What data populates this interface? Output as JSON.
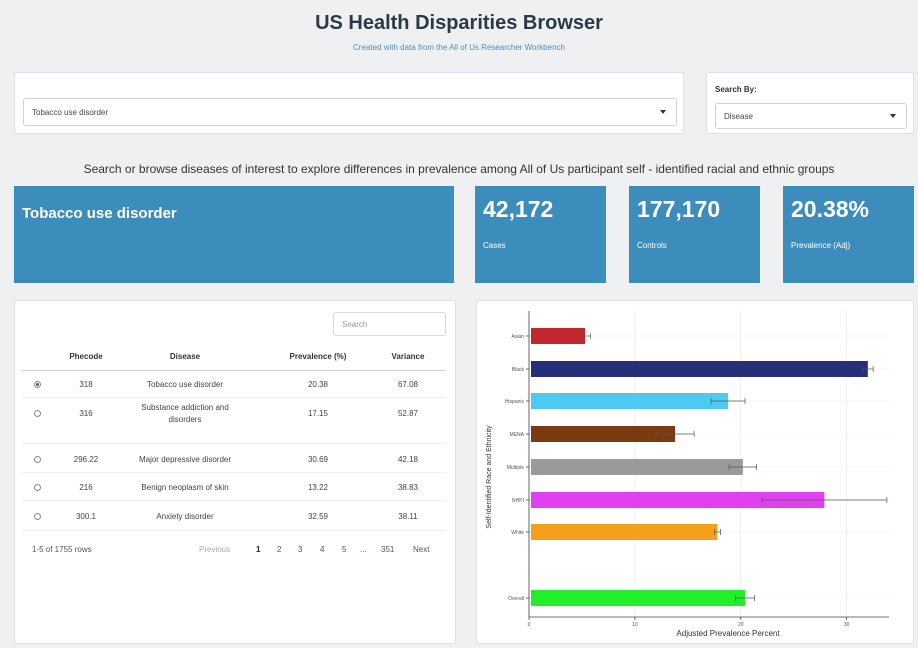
{
  "app": {
    "title": "US Health Disparities Browser",
    "subtitle": "Created with data from the All of Us Researcher Workbench"
  },
  "disease_select": {
    "value": "Tobacco use disorder"
  },
  "search_by": {
    "label": "Search By:",
    "value": "Disease"
  },
  "tagline": "Search or browse diseases of interest to explore differences in prevalence among All of Us participant self - identified racial and ethnic groups",
  "summary": {
    "disease": "Tobacco use disorder",
    "cases_value": "42,172",
    "cases_label": "Cases",
    "controls_value": "177,170",
    "controls_label": "Controls",
    "prevalence_value": "20.38%",
    "prevalence_label": "Prevalence (Adj)",
    "box_color": "#3c8dbc"
  },
  "table": {
    "search_placeholder": "Search",
    "columns": [
      "Phecode",
      "Disease",
      "Prevalence (%)",
      "Variance"
    ],
    "rows": [
      {
        "selected": true,
        "phecode": "318",
        "disease": "Tobacco use disorder",
        "prevalence": "20.38",
        "variance": "67.08"
      },
      {
        "selected": false,
        "phecode": "316",
        "disease": "Substance addiction and disorders",
        "prevalence": "17.15",
        "variance": "52.87"
      },
      {
        "selected": false,
        "phecode": "296.22",
        "disease": "Major depressive disorder",
        "prevalence": "30.69",
        "variance": "42.18"
      },
      {
        "selected": false,
        "phecode": "216",
        "disease": "Benign neoplasm of skin",
        "prevalence": "13.22",
        "variance": "38.83"
      },
      {
        "selected": false,
        "phecode": "300.1",
        "disease": "Anxiety disorder",
        "prevalence": "32.59",
        "variance": "38.11"
      }
    ],
    "info": "1-5 of 1755 rows",
    "pager": {
      "previous": "Previous",
      "pages": [
        "1",
        "2",
        "3",
        "4",
        "5",
        "...",
        "351"
      ],
      "next": "Next",
      "current": "1"
    }
  },
  "chart_data": {
    "type": "bar",
    "orientation": "horizontal",
    "ylabel": "Self-Identified Race and Ethnicity",
    "xlabel": "Adjusted Prevalence Percent",
    "xlim": [
      0,
      34
    ],
    "xticks": [
      "0",
      "10",
      "20",
      "30"
    ],
    "categories": [
      "Asian",
      "Black",
      "Hispanic",
      "MENA",
      "Multiple",
      "NHPI",
      "White",
      "Overall"
    ],
    "values": [
      5.3,
      32.0,
      18.8,
      13.8,
      20.2,
      27.9,
      17.8,
      20.4
    ],
    "error": [
      0.5,
      0.5,
      1.6,
      1.8,
      1.3,
      5.9,
      0.3,
      0.9
    ],
    "colors": [
      "#c1272d",
      "#262f7a",
      "#4ec9f2",
      "#7b3b12",
      "#9a9a9a",
      "#e040ef",
      "#f5a01a",
      "#22ef2a"
    ],
    "grid": true,
    "legend": "none"
  }
}
